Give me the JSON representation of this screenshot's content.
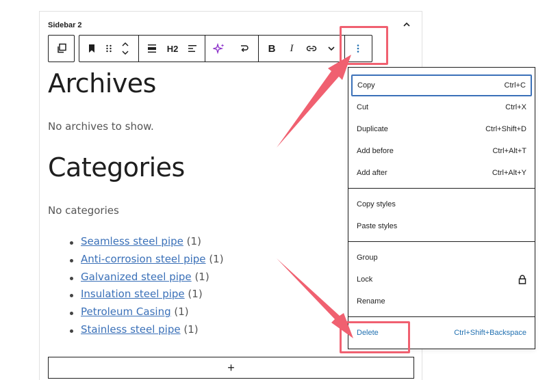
{
  "panel": {
    "title": "Sidebar 2"
  },
  "toolbar": {
    "heading_level": "H2",
    "bold": "B",
    "italic": "I"
  },
  "content": {
    "archives_heading": "Archives",
    "archives_empty": "No archives to show.",
    "categories_heading": "Categories",
    "categories_empty": "No categories",
    "categories": [
      {
        "name": "Seamless steel pipe",
        "count": "(1)"
      },
      {
        "name": "Anti-corrosion steel pipe",
        "count": "(1)"
      },
      {
        "name": "Galvanized steel pipe",
        "count": "(1)"
      },
      {
        "name": "Insulation steel pipe",
        "count": "(1)"
      },
      {
        "name": "Petroleum Casing",
        "count": "(1)"
      },
      {
        "name": "Stainless steel pipe",
        "count": "(1)"
      }
    ],
    "add_block": "+"
  },
  "menu": {
    "group1": [
      {
        "label": "Copy",
        "shortcut": "Ctrl+C"
      },
      {
        "label": "Cut",
        "shortcut": "Ctrl+X"
      },
      {
        "label": "Duplicate",
        "shortcut": "Ctrl+Shift+D"
      },
      {
        "label": "Add before",
        "shortcut": "Ctrl+Alt+T"
      },
      {
        "label": "Add after",
        "shortcut": "Ctrl+Alt+Y"
      }
    ],
    "group2": [
      {
        "label": "Copy styles"
      },
      {
        "label": "Paste styles"
      }
    ],
    "group3": [
      {
        "label": "Group"
      },
      {
        "label": "Lock",
        "icon": "lock-icon"
      },
      {
        "label": "Rename"
      }
    ],
    "delete": {
      "label": "Delete",
      "shortcut": "Ctrl+Shift+Backspace"
    }
  },
  "colors": {
    "annotation": "#f06070",
    "link": "#3a70b8",
    "focus": "#3a70b8",
    "delete": "#2271b1"
  }
}
